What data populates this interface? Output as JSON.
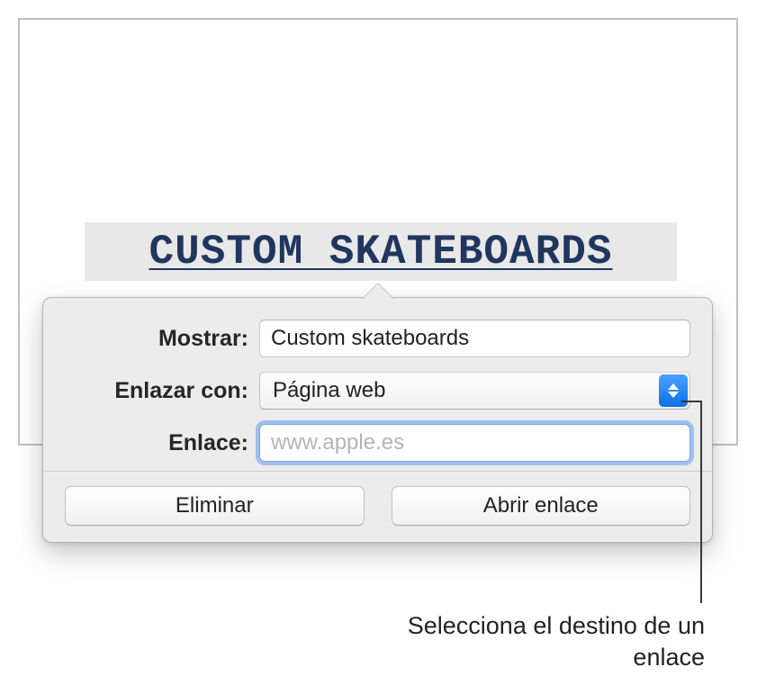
{
  "selected_link_text": "CUSTOM SKATEBOARDS",
  "popover": {
    "display": {
      "label": "Mostrar:",
      "value": "Custom skateboards"
    },
    "link_to": {
      "label": "Enlazar con:",
      "value": "Página web"
    },
    "url": {
      "label": "Enlace:",
      "placeholder": "www.apple.es",
      "value": ""
    },
    "buttons": {
      "delete": "Eliminar",
      "open": "Abrir enlace"
    }
  },
  "callout": "Selecciona el destino de un enlace"
}
